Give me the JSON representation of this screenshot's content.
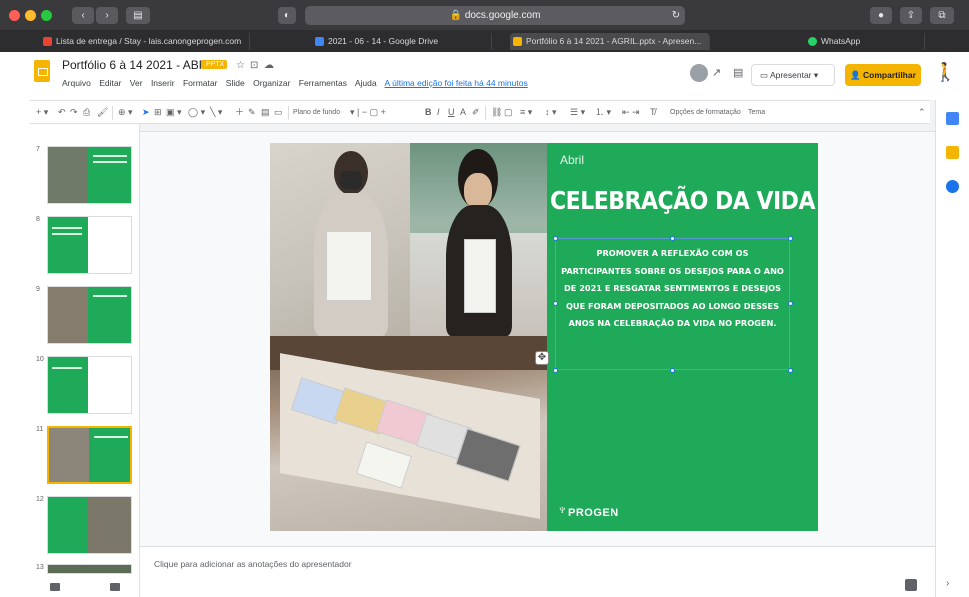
{
  "browser": {
    "url": "docs.google.com",
    "tabs": [
      {
        "label": "Lista de entrega / Stay - lais.canongeprogen.com",
        "color": "#ea4335"
      },
      {
        "label": "2021 - 06 - 14 - Google Drive",
        "color": "#4285f4"
      },
      {
        "label": "Portfólio 6 à 14 2021 - AGRIL.pptx - Apresen...",
        "color": "#f4b400"
      },
      {
        "label": "WhatsApp",
        "color": "#25d366"
      }
    ]
  },
  "doc": {
    "title": "Portfólio 6 à 14 2021 - ABRIL",
    "badge": ".PPTX",
    "menus": [
      "Arquivo",
      "Editar",
      "Ver",
      "Inserir",
      "Formatar",
      "Slide",
      "Organizar",
      "Ferramentas",
      "Ajuda"
    ],
    "last_edit": "A última edição foi feita há 44 minutos",
    "present_label": "Apresentar",
    "share_label": "Compartilhar"
  },
  "toolbar": {
    "background_label": "Plano de fundo",
    "layout_label": "Layout",
    "theme_label": "Tema",
    "transition_label": "Opções de formatação"
  },
  "slide": {
    "month": "Abril",
    "title": "CELEBRAÇÃO DA VIDA",
    "body": "PROMOVER A REFLEXÃO COM OS PARTICIPANTES SOBRE OS DESEJOS PARA O ANO DE 2021 E RESGATAR SENTIMENTOS E DESEJOS QUE FORAM DEPOSITADOS AO LONGO DESSES ANOS NA CELEBRAÇÃO DA VIDA NO PROGEN.",
    "logo_text": "PROGEN",
    "green": "#1faa59"
  },
  "filmstrip": {
    "numbers": [
      "7",
      "8",
      "9",
      "10",
      "11",
      "12",
      "13"
    ]
  },
  "notes": {
    "placeholder": "Clique para adicionar as anotações do apresentador"
  },
  "colors": {
    "accent": "#f4b400",
    "link": "#1a73e8"
  }
}
